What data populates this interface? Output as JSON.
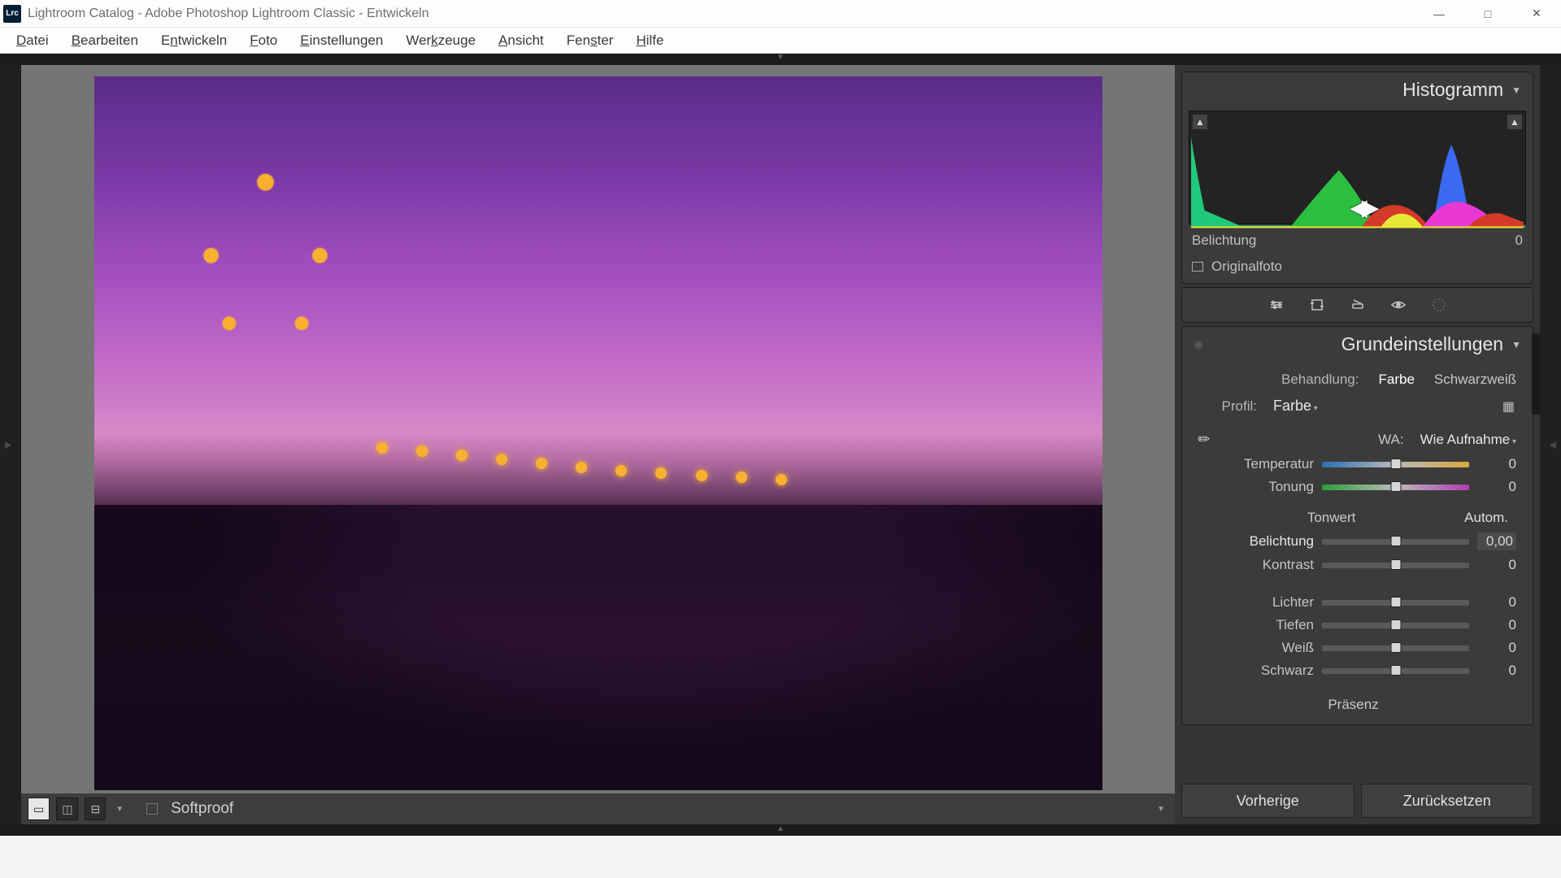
{
  "window": {
    "title": "Lightroom Catalog - Adobe Photoshop Lightroom Classic - Entwickeln",
    "icon_text": "Lrc"
  },
  "menu": [
    "Datei",
    "Bearbeiten",
    "Entwickeln",
    "Foto",
    "Einstellungen",
    "Werkzeuge",
    "Ansicht",
    "Fenster",
    "Hilfe"
  ],
  "toolbar": {
    "softproof": "Softproof"
  },
  "panels": {
    "histogram": {
      "title": "Histogramm",
      "readout_label": "Belichtung",
      "readout_value": "0",
      "original": "Originalfoto"
    },
    "basic": {
      "title": "Grundeinstellungen",
      "treatment_label": "Behandlung:",
      "treatment_color": "Farbe",
      "treatment_bw": "Schwarzweiß",
      "profile_label": "Profil:",
      "profile_value": "Farbe",
      "wb_label": "WA:",
      "wb_value": "Wie Aufnahme",
      "sliders": {
        "temp": {
          "label": "Temperatur",
          "value": "0"
        },
        "tint": {
          "label": "Tonung",
          "value": "0"
        }
      },
      "tone_header": "Tonwert",
      "auto": "Autom.",
      "tone": {
        "exposure": {
          "label": "Belichtung",
          "value": "0,00"
        },
        "contrast": {
          "label": "Kontrast",
          "value": "0"
        },
        "highlights": {
          "label": "Lichter",
          "value": "0"
        },
        "shadows": {
          "label": "Tiefen",
          "value": "0"
        },
        "whites": {
          "label": "Weiß",
          "value": "0"
        },
        "blacks": {
          "label": "Schwarz",
          "value": "0"
        }
      },
      "presence_header": "Präsenz"
    }
  },
  "buttons": {
    "previous": "Vorherige",
    "reset": "Zurücksetzen"
  }
}
